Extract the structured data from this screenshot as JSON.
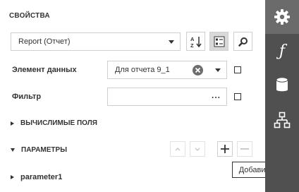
{
  "panel": {
    "title": "СВОЙСТВА",
    "selector": {
      "value": "Report (Отчет)"
    },
    "toolbar": {
      "sort_icon": "sort-az-icon",
      "categories_icon": "categories-icon",
      "search_icon": "search-icon"
    }
  },
  "properties": [
    {
      "label": "Элемент данных",
      "value": "Для отчета 9_1"
    },
    {
      "label": "Фильтр",
      "value": "",
      "editor": "..."
    }
  ],
  "sections": {
    "calculated": "ВЫЧИСЛИМЫЕ ПОЛЯ",
    "parameters": "ПАРАМЕТРЫ",
    "parameter1": "parameter1"
  },
  "tooltip": "Добавить",
  "sidebar": {
    "tabs": [
      {
        "icon": "gear-icon",
        "active": true
      },
      {
        "icon": "function-icon",
        "glyph": "ƒ"
      },
      {
        "icon": "database-icon"
      },
      {
        "icon": "hierarchy-icon"
      }
    ]
  }
}
